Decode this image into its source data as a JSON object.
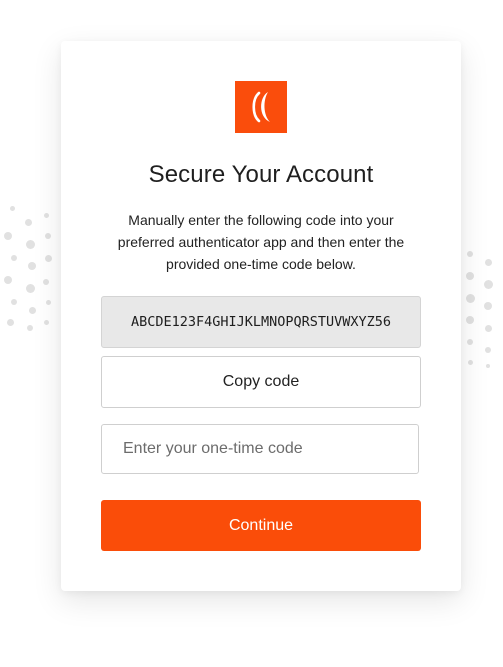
{
  "brand": {
    "logo_icon": "brand-logo-icon",
    "accent_color": "#fa4d0c"
  },
  "card": {
    "title": "Secure Your Account",
    "description": "Manually enter the following code into your preferred authenticator app and then enter the provided one-time code below.",
    "secret_code": "ABCDE123F4GHIJKLMNOPQRSTUVWXYZ56",
    "copy_button_label": "Copy code",
    "otp_input": {
      "value": "",
      "placeholder": "Enter your one-time code"
    },
    "continue_button_label": "Continue"
  }
}
